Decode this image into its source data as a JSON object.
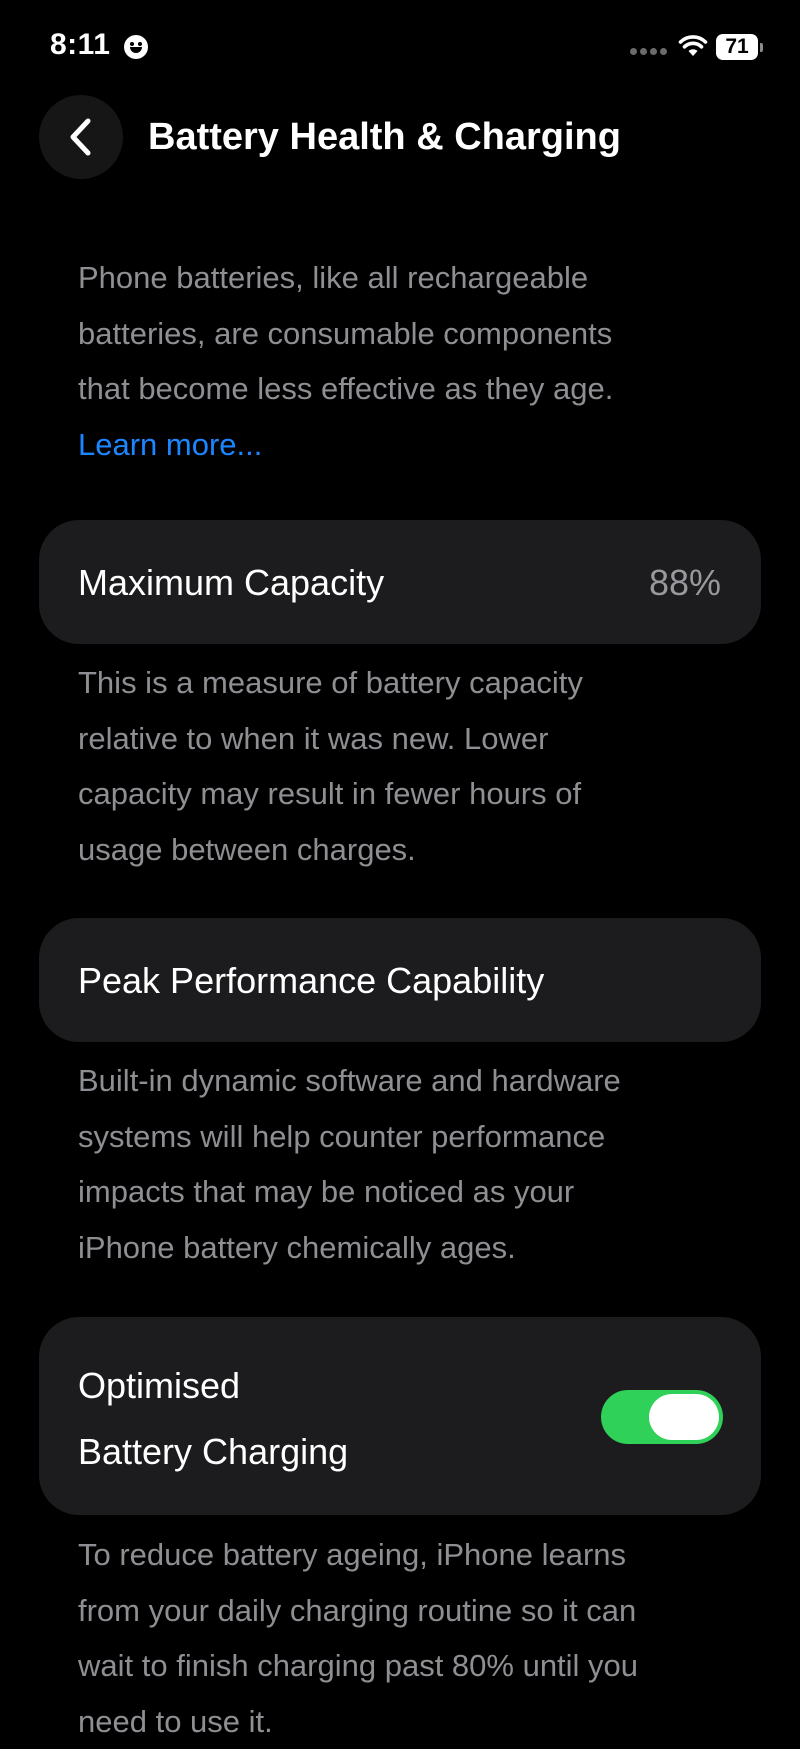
{
  "status_bar": {
    "time": "8:11",
    "battery_level": "71",
    "icons": [
      "smiley-icon",
      "signal-dots-icon",
      "wifi-icon",
      "battery-icon"
    ]
  },
  "header": {
    "title": "Battery Health & Charging",
    "back_icon": "chevron-left-icon"
  },
  "intro": {
    "lines": [
      "Phone batteries, like all rechargeable",
      "batteries, are consumable components",
      "that become less effective as they age."
    ],
    "learn_more": "Learn more..."
  },
  "maximum_capacity": {
    "label": "Maximum Capacity",
    "value": "88%",
    "description_lines": [
      "This is a measure of battery capacity",
      "relative to when it was new. Lower",
      "capacity may result in fewer hours of",
      "usage between charges."
    ]
  },
  "peak_performance": {
    "label": "Peak Performance Capability",
    "description_lines": [
      "Built-in dynamic software and hardware",
      "systems will help counter performance",
      "impacts that may be noticed as your",
      "iPhone battery chemically ages."
    ]
  },
  "optimised_charging": {
    "label_line1": "Optimised",
    "label_line2": "Battery Charging",
    "enabled": true,
    "description_lines": [
      "To reduce battery ageing, iPhone learns",
      "from your daily charging routine so it can",
      "wait to finish charging past 80% until you",
      "need to use it."
    ]
  },
  "colors": {
    "background": "#000000",
    "card": "#1c1c1e",
    "secondary_text": "#8e8e93",
    "link": "#1c86ff",
    "toggle_on": "#30d158"
  }
}
